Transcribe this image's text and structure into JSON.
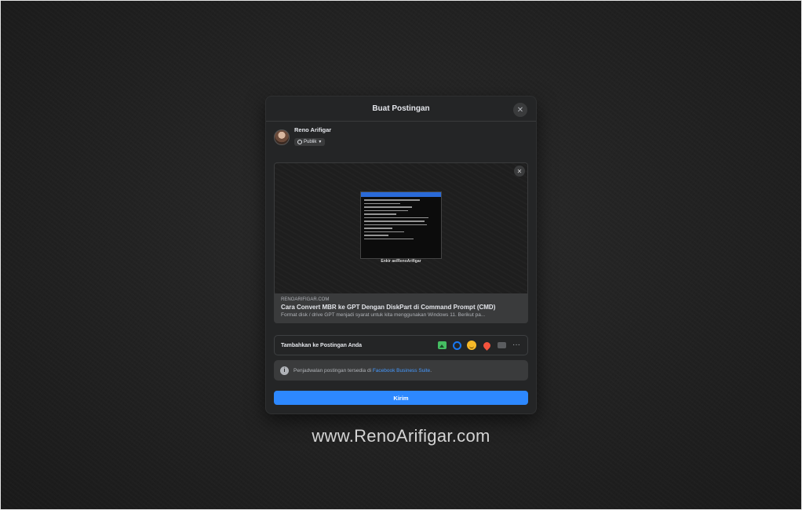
{
  "modal": {
    "title": "Buat Postingan",
    "close_icon": "close-icon"
  },
  "author": {
    "name": "Reno Arifigar",
    "privacy": "Publik"
  },
  "link_preview": {
    "image_caption": "Enkir ae/RenoArifigar",
    "domain": "RENOARIFIGAR.COM",
    "title": "Cara Convert MBR ke GPT Dengan DiskPart di Command Prompt (CMD)",
    "description": "Format disk / drive GPT menjadi syarat untuk kita menggunakan Windows 11. Berikut pa..."
  },
  "add_to_post": {
    "label": "Tambahkan ke Postingan Anda",
    "tools": [
      "photo-video-icon",
      "tag-people-icon",
      "feeling-icon",
      "check-in-icon",
      "live-video-icon",
      "more-icon"
    ],
    "more_glyph": "···"
  },
  "schedule_note": {
    "text": "Penjadwalan postingan tersedia di ",
    "link": "Facebook Business Suite",
    "suffix": "."
  },
  "submit": {
    "label": "Kirim"
  },
  "watermark": "www.RenoArifigar.com",
  "colors": {
    "modal_bg": "#242526",
    "primary": "#2d88ff",
    "link": "#4599ff"
  }
}
